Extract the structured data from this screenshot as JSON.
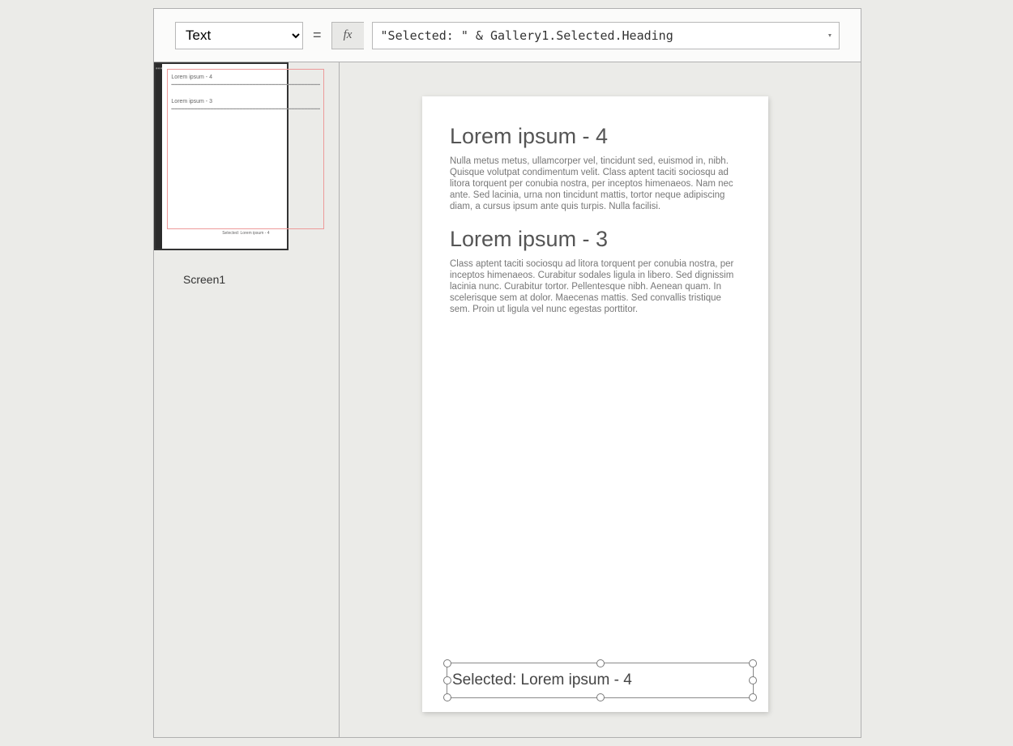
{
  "formulaBar": {
    "property": "Text",
    "equals": "=",
    "fx": "fx",
    "formula": "\"Selected: \" & Gallery1.Selected.Heading"
  },
  "screensPanel": {
    "screenLabel": "Screen1",
    "thumb": {
      "heading1": "Lorem ipsum - 4",
      "heading2": "Lorem ipsum - 3",
      "selectedText": "Selected: Lorem ipsum - 4"
    }
  },
  "canvas": {
    "items": [
      {
        "heading": "Lorem ipsum - 4",
        "body": "Nulla metus metus, ullamcorper vel, tincidunt sed, euismod in, nibh. Quisque volutpat condimentum velit. Class aptent taciti sociosqu ad litora torquent per conubia nostra, per inceptos himenaeos. Nam nec ante. Sed lacinia, urna non tincidunt mattis, tortor neque adipiscing diam, a cursus ipsum ante quis turpis. Nulla facilisi."
      },
      {
        "heading": "Lorem ipsum - 3",
        "body": "Class aptent taciti sociosqu ad litora torquent per conubia nostra, per inceptos himenaeos. Curabitur sodales ligula in libero. Sed dignissim lacinia nunc. Curabitur tortor. Pellentesque nibh. Aenean quam. In scelerisque sem at dolor. Maecenas mattis. Sed convallis tristique sem. Proin ut ligula vel nunc egestas porttitor."
      }
    ],
    "selectedLabel": "Selected: Lorem ipsum - 4"
  }
}
